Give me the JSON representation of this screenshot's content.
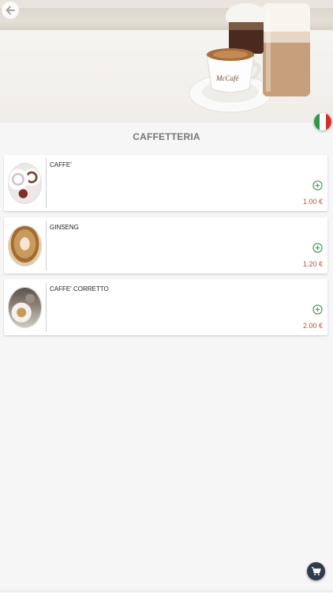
{
  "header": {
    "back_icon": "arrow-left-icon",
    "language_flag": {
      "name": "italian-flag-icon",
      "colors": [
        "#2c9a45",
        "#ffffff",
        "#d2302d"
      ]
    },
    "hero_logo_text": "McCafé"
  },
  "section": {
    "title": "CAFFETTERIA"
  },
  "colors": {
    "price": "#b5533b",
    "add_icon": "#3c9a47",
    "cart_button": "#2f3a4c"
  },
  "products": [
    {
      "name": "CAFFE'",
      "price": "1.00 €",
      "add_icon": "plus-circle-icon"
    },
    {
      "name": "GINSENG",
      "price": "1.20 €",
      "add_icon": "plus-circle-icon"
    },
    {
      "name": "CAFFE' CORRETTO",
      "price": "2.00 €",
      "add_icon": "plus-circle-icon"
    }
  ],
  "cart": {
    "icon": "cart-icon"
  }
}
